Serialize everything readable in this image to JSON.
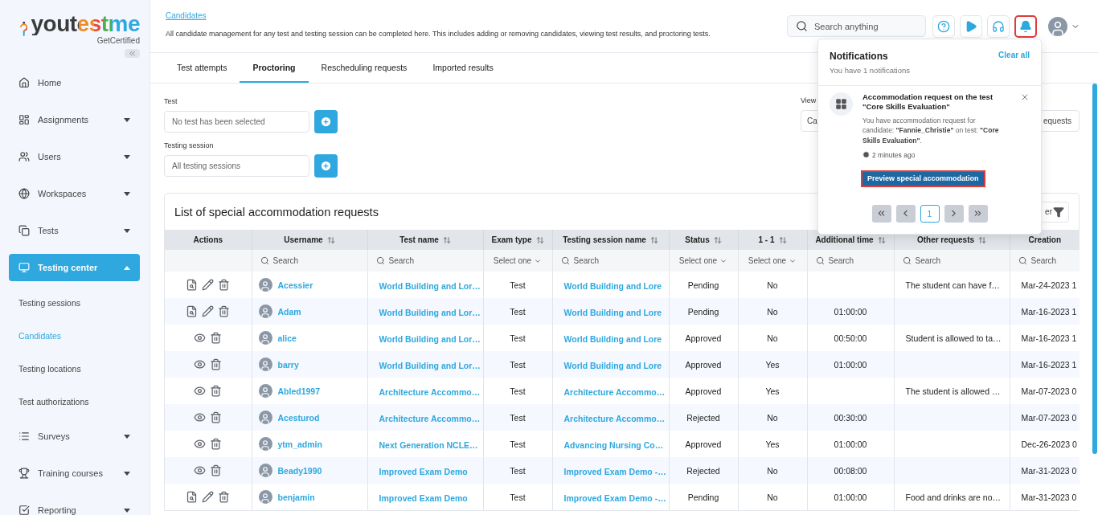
{
  "logo": {
    "wordmark": "youtestme",
    "tagline": "GetCertified"
  },
  "sidebar": {
    "items": [
      {
        "label": "Home",
        "kind": "link",
        "selected": false
      },
      {
        "label": "Assignments",
        "kind": "group",
        "expanded": false,
        "selected": false
      },
      {
        "label": "Users",
        "kind": "group",
        "expanded": false,
        "selected": false
      },
      {
        "label": "Workspaces",
        "kind": "group",
        "expanded": false,
        "selected": false
      },
      {
        "label": "Tests",
        "kind": "group",
        "expanded": false,
        "selected": false
      },
      {
        "label": "Testing center",
        "kind": "group",
        "expanded": true,
        "selected": true,
        "children": [
          {
            "label": "Testing sessions",
            "selected": false
          },
          {
            "label": "Candidates",
            "selected": true
          },
          {
            "label": "Testing locations",
            "selected": false
          },
          {
            "label": "Test authorizations",
            "selected": false
          }
        ]
      },
      {
        "label": "Surveys",
        "kind": "group",
        "expanded": false,
        "selected": false
      },
      {
        "label": "Training courses",
        "kind": "group",
        "expanded": false,
        "selected": false
      },
      {
        "label": "Reporting",
        "kind": "group",
        "expanded": false,
        "selected": false
      }
    ]
  },
  "header": {
    "breadcrumb": "Candidates",
    "description": "All candidate management for any test and testing session can be completed here. This includes adding or removing candidates, viewing test results, and proctoring tests.",
    "search": {
      "placeholder": "Search anything"
    },
    "buttons": [
      {
        "kind": "help",
        "selected": false
      },
      {
        "kind": "play",
        "selected": false
      },
      {
        "kind": "headset",
        "selected": false
      },
      {
        "kind": "bell",
        "selected": true
      }
    ]
  },
  "tabs": [
    {
      "label": "Test attempts",
      "selected": false
    },
    {
      "label": "Proctoring",
      "selected": true
    },
    {
      "label": "Rescheduling requests",
      "selected": false
    },
    {
      "label": "Imported results",
      "selected": false
    }
  ],
  "filters": [
    {
      "label": "Test",
      "placeholder": "No test has been selected"
    },
    {
      "label": "Testing session",
      "placeholder": "All testing sessions"
    }
  ],
  "view": {
    "label": "View",
    "text_start": "Ca",
    "text_end": "equests"
  },
  "table": {
    "title": "List of special accommodation requests",
    "filter_button": "er",
    "columns": [
      {
        "label": "Actions",
        "sortable": false
      },
      {
        "label": "Username",
        "sortable": true,
        "filter": {
          "kind": "search",
          "placeholder": "Search"
        }
      },
      {
        "label": "Test name",
        "sortable": true,
        "filter": {
          "kind": "search",
          "placeholder": "Search"
        }
      },
      {
        "label": "Exam type",
        "sortable": true,
        "filter": {
          "kind": "select",
          "text": "Select one"
        }
      },
      {
        "label": "Testing session name",
        "sortable": true,
        "filter": {
          "kind": "search",
          "placeholder": "Search"
        }
      },
      {
        "label": "Status",
        "sortable": true,
        "filter": {
          "kind": "select",
          "text": "Select one"
        }
      },
      {
        "label": "1 - 1",
        "sortable": true,
        "filter": {
          "kind": "select",
          "text": "Select one"
        }
      },
      {
        "label": "Additional time",
        "sortable": true,
        "filter": {
          "kind": "search",
          "placeholder": "Search"
        }
      },
      {
        "label": "Other requests",
        "sortable": true,
        "filter": {
          "kind": "search",
          "placeholder": "Search"
        }
      },
      {
        "label": "Creation",
        "sortable": false,
        "filter": {
          "kind": "search",
          "placeholder": "Search"
        }
      }
    ],
    "rows": [
      {
        "kind": "editable",
        "username": "Acessier",
        "test_name": "World Building and Lor…",
        "exam_type": "Test",
        "session": "World Building and Lore",
        "status": "Pending",
        "one_to_one": "No",
        "other_requests": "The student can have f…",
        "creation": "Mar-24-2023 1"
      },
      {
        "kind": "editable",
        "username": "Adam",
        "test_name": "World Building and Lor…",
        "exam_type": "Test",
        "session": "World Building and Lore",
        "status": "Pending",
        "one_to_one": "No",
        "additional_time": "01:00:00",
        "creation": "Mar-16-2023 1"
      },
      {
        "kind": "readonly",
        "username": "alice",
        "test_name": "World Building and Lor…",
        "exam_type": "Test",
        "session": "World Building and Lore",
        "status": "Approved",
        "one_to_one": "No",
        "additional_time": "00:50:00",
        "other_requests": "Student is allowed to ta…",
        "creation": "Mar-16-2023 1"
      },
      {
        "kind": "readonly",
        "username": "barry",
        "test_name": "World Building and Lor…",
        "exam_type": "Test",
        "session": "World Building and Lore",
        "status": "Approved",
        "one_to_one": "Yes",
        "additional_time": "01:00:00",
        "creation": "Mar-16-2023 1"
      },
      {
        "kind": "readonly",
        "username": "Abled1997",
        "test_name": "Architecture Accommo…",
        "exam_type": "Test",
        "session": "Architecture Accommo…",
        "status": "Approved",
        "one_to_one": "Yes",
        "other_requests": "The student is allowed …",
        "creation": "Mar-07-2023 0"
      },
      {
        "kind": "readonly",
        "username": "Acesturod",
        "test_name": "Architecture Accommo…",
        "exam_type": "Test",
        "session": "Architecture Accommo…",
        "status": "Rejected",
        "one_to_one": "No",
        "additional_time": "00:30:00",
        "creation": "Mar-07-2023 0"
      },
      {
        "kind": "readonly",
        "username": "ytm_admin",
        "test_name": "Next Generation NCLE…",
        "exam_type": "Test",
        "session": "Advancing Nursing Co…",
        "status": "Approved",
        "one_to_one": "Yes",
        "additional_time": "01:00:00",
        "creation": "Dec-26-2023 0"
      },
      {
        "kind": "readonly",
        "username": "Beady1990",
        "test_name": "Improved Exam Demo",
        "exam_type": "Test",
        "session": "Improved Exam Demo -…",
        "status": "Rejected",
        "one_to_one": "No",
        "additional_time": "00:08:00",
        "creation": "Mar-31-2023 0"
      },
      {
        "kind": "editable",
        "username": "benjamin",
        "test_name": "Improved Exam Demo",
        "exam_type": "Test",
        "session": "Improved Exam Demo -…",
        "status": "Pending",
        "one_to_one": "No",
        "additional_time": "01:00:00",
        "other_requests": "Food and drinks are no…",
        "creation": "Mar-31-2023 0"
      }
    ]
  },
  "notifications": {
    "title": "Notifications",
    "subtitle": "You have 1 notifications",
    "clear_all": "Clear all",
    "items": [
      {
        "title": "Accommodation request on the test \"Core Skills Evaluation\"",
        "body": "You have accommodation request for candidate: **\"Fannie_Christie\"** on test: **\"Core Skills Evaluation\"**.",
        "time": "2 minutes ago",
        "action": "Preview special accommodation",
        "highlighted": true
      }
    ],
    "pages": [
      {
        "label": "1",
        "selected": true
      }
    ]
  }
}
